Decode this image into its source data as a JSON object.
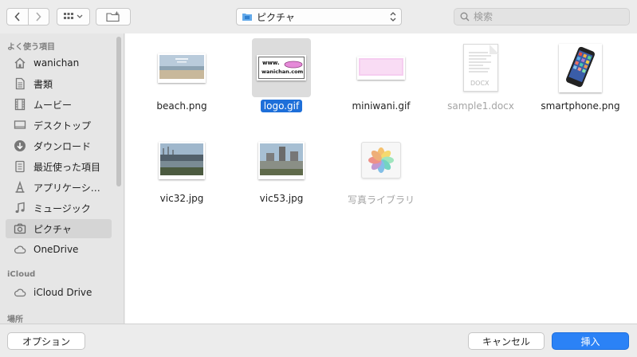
{
  "toolbar": {
    "location": "ピクチャ",
    "search_placeholder": "検索"
  },
  "sidebar": {
    "sections": {
      "favorites": "よく使う項目",
      "icloud": "iCloud",
      "locations": "場所"
    },
    "items": [
      {
        "label": "wanichan",
        "icon": "home-icon"
      },
      {
        "label": "書類",
        "icon": "document-icon"
      },
      {
        "label": "ムービー",
        "icon": "film-icon"
      },
      {
        "label": "デスクトップ",
        "icon": "desktop-icon"
      },
      {
        "label": "ダウンロード",
        "icon": "download-icon"
      },
      {
        "label": "最近使った項目",
        "icon": "recent-icon"
      },
      {
        "label": "アプリケーシ…",
        "icon": "applications-icon"
      },
      {
        "label": "ミュージック",
        "icon": "music-icon"
      },
      {
        "label": "ピクチャ",
        "icon": "camera-icon",
        "selected": true
      },
      {
        "label": "OneDrive",
        "icon": "cloud-icon"
      },
      {
        "label": "iCloud Drive",
        "icon": "cloud-icon"
      }
    ]
  },
  "files": [
    {
      "name": "beach.png"
    },
    {
      "name": "logo.gif",
      "selected": true,
      "thumb_text_1": "www.",
      "thumb_text_2": "wanichan.com"
    },
    {
      "name": "miniwani.gif"
    },
    {
      "name": "sample1.docx",
      "dim": true,
      "thumb_text": "DOCX"
    },
    {
      "name": "smartphone.png"
    },
    {
      "name": "vic32.jpg"
    },
    {
      "name": "vic53.jpg"
    },
    {
      "name": "写真ライブラリ",
      "dim": true
    }
  ],
  "buttons": {
    "options": "オプション",
    "cancel": "キャンセル",
    "insert": "挿入"
  },
  "colors": {
    "accent": "#2b82f6",
    "selection": "#1e6fd9"
  }
}
